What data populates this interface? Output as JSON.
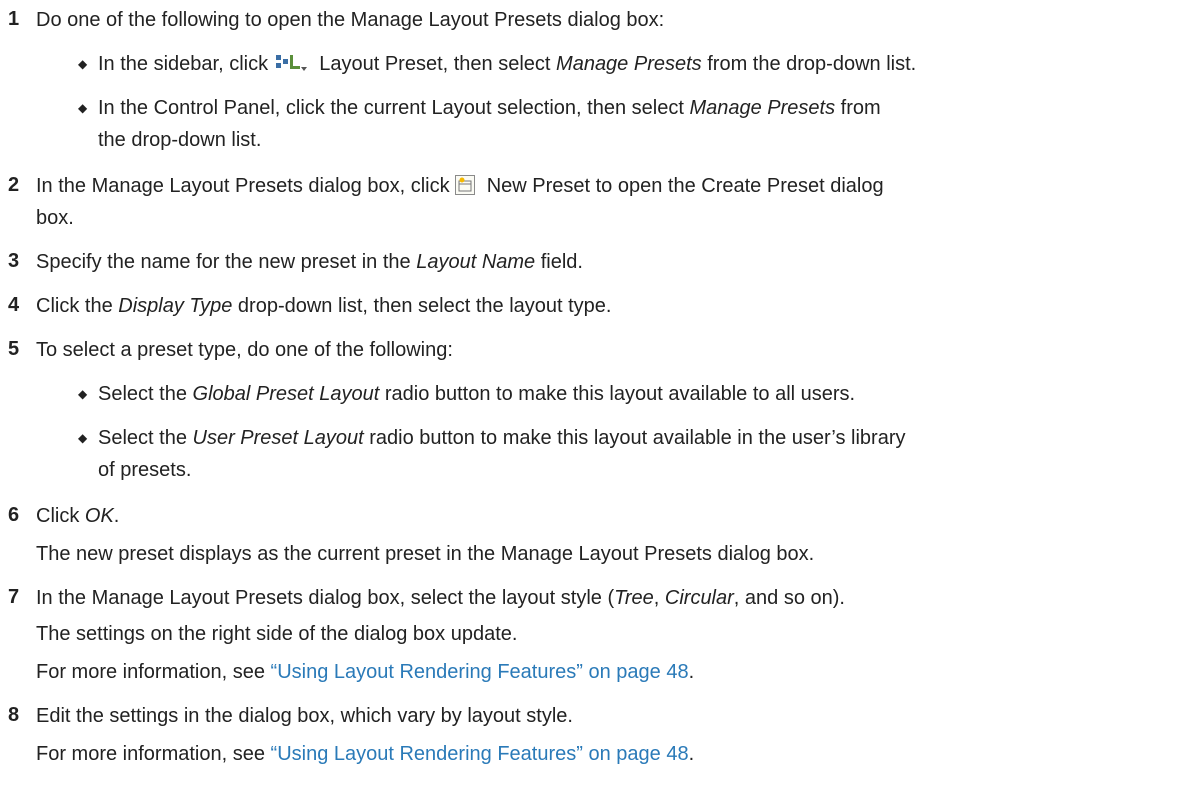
{
  "steps": [
    {
      "num": "1",
      "text": "Do one of the following to open the Manage Layout Presets dialog box:"
    },
    {
      "num": "2",
      "pre": "In the Manage Layout Presets dialog box, click ",
      "icon": "new-preset-icon",
      "post": " New Preset to open the Create Preset dialog",
      "cont": "box."
    },
    {
      "num": "3",
      "pre": "Specify the name for the new preset in the ",
      "em": "Layout Name",
      "post": " field."
    },
    {
      "num": "4",
      "pre": "Click the ",
      "em": "Display Type",
      "post": " drop-down list, then select the layout type."
    },
    {
      "num": "5",
      "text": "To select a preset type, do one of the following:"
    },
    {
      "num": "6",
      "pre": "Click ",
      "em": "OK",
      "post": ".",
      "result": "The new preset displays as the current preset in the Manage Layout Presets dialog box."
    },
    {
      "num": "7",
      "pre": "In the Manage Layout Presets dialog box, select the layout style (",
      "em1": "Tree",
      "mid": ", ",
      "em2": "Circular",
      "post": ", and so on).",
      "result": "The settings on the right side of the dialog box update.",
      "more_pre": "For more information, see ",
      "link": "“Using Layout Rendering Features” on page 48",
      "more_post": "."
    },
    {
      "num": "8",
      "text": "Edit the settings in the dialog box, which vary by layout style.",
      "more_pre": "For more information, see ",
      "link": "“Using Layout Rendering Features” on page 48",
      "more_post": "."
    }
  ],
  "step1_bullets": [
    {
      "pre": "In the sidebar, click ",
      "icon": "layout-preset-icon",
      "mid": " Layout Preset, then select ",
      "em": "Manage Presets",
      "post": " from the drop-down list."
    },
    {
      "pre": "In the Control Panel, click the current Layout selection, then select ",
      "em": "Manage Presets",
      "post": " from",
      "cont": "the drop-down list."
    }
  ],
  "step5_bullets": [
    {
      "pre": "Select the ",
      "em": "Global Preset Layout",
      "post": " radio button to make this layout available to all users."
    },
    {
      "pre": "Select the ",
      "em": "User Preset Layout",
      "post": " radio button to make this layout available in the user’s library",
      "cont": "of presets."
    }
  ],
  "bullet_char": "◆",
  "colors": {
    "link": "#2a7ab8",
    "text": "#222222"
  }
}
